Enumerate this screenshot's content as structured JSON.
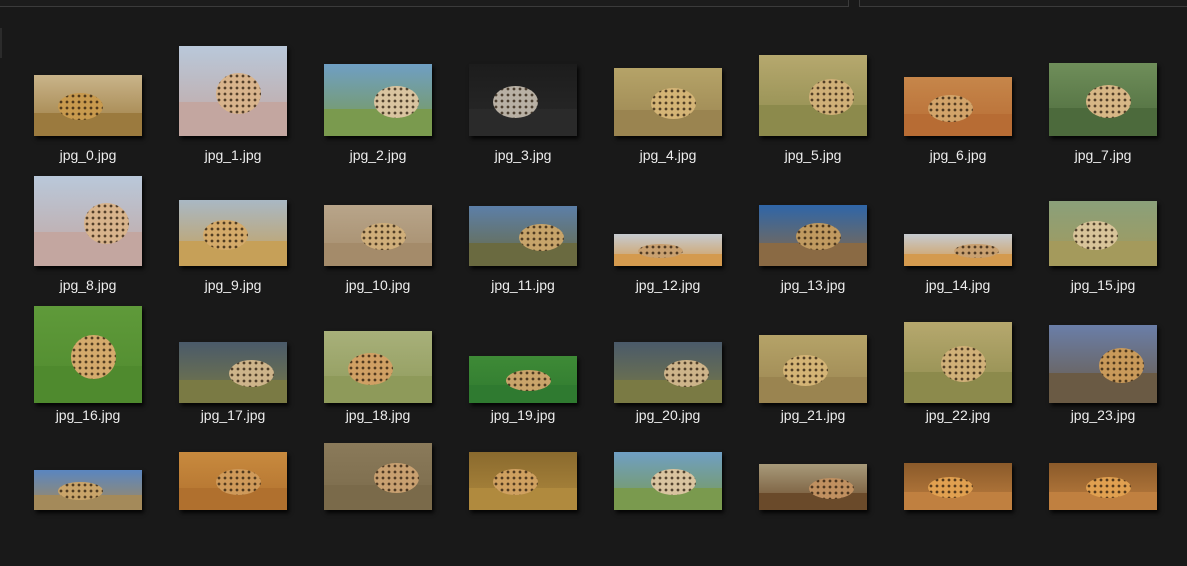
{
  "files": [
    {
      "name": "jpg_0.jpg",
      "sky": "#c9b48a",
      "ground": "#9b7a3e",
      "animal": "#c89a4e"
    },
    {
      "name": "jpg_1.jpg",
      "sky": "#b9c8da",
      "ground": "#c3a6a0",
      "animal": "#d8b48c"
    },
    {
      "name": "jpg_2.jpg",
      "sky": "#6f9fc4",
      "ground": "#7a9a4e",
      "animal": "#d9c4a0"
    },
    {
      "name": "jpg_3.jpg",
      "sky": "#1c1c1c",
      "ground": "#2a2a2a",
      "animal": "#b8b0a4"
    },
    {
      "name": "jpg_4.jpg",
      "sky": "#b5a368",
      "ground": "#9a8450",
      "animal": "#d4b476"
    },
    {
      "name": "jpg_5.jpg",
      "sky": "#b6a86e",
      "ground": "#8c8a4c",
      "animal": "#d0b078"
    },
    {
      "name": "jpg_6.jpg",
      "sky": "#c6864a",
      "ground": "#b76c34",
      "animal": "#d2a46a"
    },
    {
      "name": "jpg_7.jpg",
      "sky": "#6f8e5a",
      "ground": "#4c6a3c",
      "animal": "#d7b786"
    },
    {
      "name": "jpg_8.jpg",
      "sky": "#b9c8da",
      "ground": "#c3a6a0",
      "animal": "#d8b48c"
    },
    {
      "name": "jpg_9.jpg",
      "sky": "#a9b8c4",
      "ground": "#c6a058",
      "animal": "#d4aa6a"
    },
    {
      "name": "jpg_10.jpg",
      "sky": "#b8a58a",
      "ground": "#a48b6a",
      "animal": "#cfae7a"
    },
    {
      "name": "jpg_11.jpg",
      "sky": "#5c7fa8",
      "ground": "#6a6a40",
      "animal": "#c7a46a"
    },
    {
      "name": "jpg_12.jpg",
      "sky": "#c6cbd0",
      "ground": "#d49a4e",
      "animal": "#c8a070"
    },
    {
      "name": "jpg_13.jpg",
      "sky": "#2f66a8",
      "ground": "#8a6a44",
      "animal": "#c09a60"
    },
    {
      "name": "jpg_14.jpg",
      "sky": "#c6cbd0",
      "ground": "#d49a4e",
      "animal": "#c8a070"
    },
    {
      "name": "jpg_15.jpg",
      "sky": "#8aa07a",
      "ground": "#a49a5c",
      "animal": "#d8c49a"
    },
    {
      "name": "jpg_16.jpg",
      "sky": "#5f9a3a",
      "ground": "#4f8a2e",
      "animal": "#d4aa6c"
    },
    {
      "name": "jpg_17.jpg",
      "sky": "#4a5a6a",
      "ground": "#7a7a44",
      "animal": "#cdb48a"
    },
    {
      "name": "jpg_18.jpg",
      "sky": "#a8b07a",
      "ground": "#8e9a5a",
      "animal": "#d0a064"
    },
    {
      "name": "jpg_19.jpg",
      "sky": "#3e8a36",
      "ground": "#2f7a30",
      "animal": "#c9a46a"
    },
    {
      "name": "jpg_20.jpg",
      "sky": "#4a5a6a",
      "ground": "#7a7a44",
      "animal": "#cdb48a"
    },
    {
      "name": "jpg_21.jpg",
      "sky": "#b5a368",
      "ground": "#9a8450",
      "animal": "#d4b476"
    },
    {
      "name": "jpg_22.jpg",
      "sky": "#b6a86e",
      "ground": "#8c8a4c",
      "animal": "#d0b078"
    },
    {
      "name": "jpg_23.jpg",
      "sky": "#6a7ea8",
      "ground": "#6a5a44",
      "animal": "#c99a5a"
    },
    {
      "name": "",
      "sky": "#5a86c0",
      "ground": "#a48a5a",
      "animal": "#c9a46a"
    },
    {
      "name": "",
      "sky": "#c88a3e",
      "ground": "#b0702e",
      "animal": "#cf9a5a"
    },
    {
      "name": "",
      "sky": "#8a7a5a",
      "ground": "#7a6a4a",
      "animal": "#c8a070"
    },
    {
      "name": "",
      "sky": "#8a6a2e",
      "ground": "#b08a3e",
      "animal": "#cfa060"
    },
    {
      "name": "",
      "sky": "#6f9fc4",
      "ground": "#7a9a4e",
      "animal": "#d9c4a0"
    },
    {
      "name": "",
      "sky": "#a89a7a",
      "ground": "#6a4a2a",
      "animal": "#c09060"
    },
    {
      "name": "",
      "sky": "#8a5a2a",
      "ground": "#c08040",
      "animal": "#e0a050"
    },
    {
      "name": "",
      "sky": "#8a5a2a",
      "ground": "#c08040",
      "animal": "#e0a050"
    }
  ]
}
